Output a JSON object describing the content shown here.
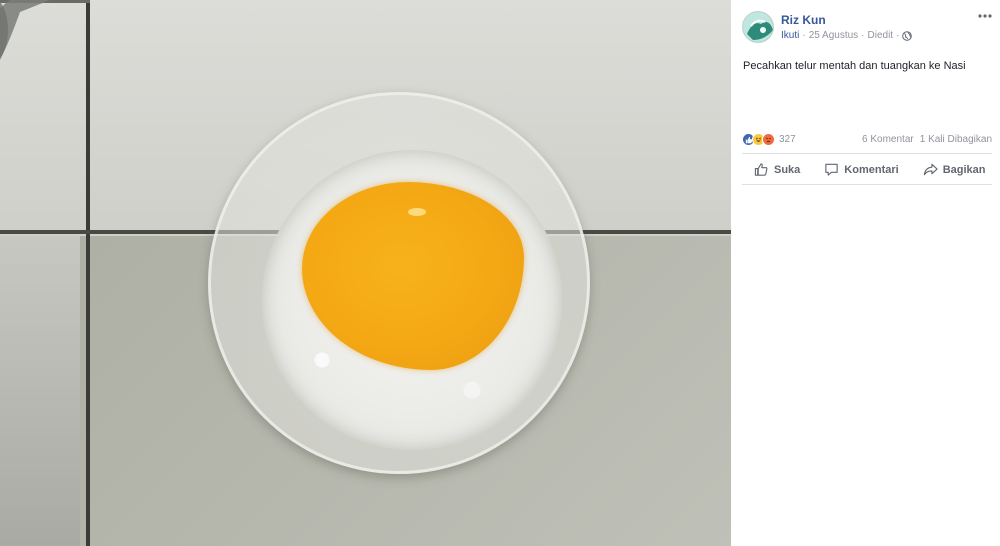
{
  "post": {
    "author": "Riz Kun",
    "follow_label": "Ikuti",
    "separator": "·",
    "date": "25 Agustus",
    "edited": "Diedit",
    "text": "Pecahkan telur mentah dan tuangkan ke Nasi",
    "reaction_count": "327",
    "comments": "6 Komentar",
    "shares": "1 Kali Dibagikan"
  },
  "actions": {
    "like": "Suka",
    "comment": "Komentari",
    "share": "Bagikan"
  },
  "icons": {
    "avatar": "avatar",
    "globe": "globe-icon",
    "more": "more-options-icon",
    "like_reaction": "like-reaction-icon",
    "haha_reaction": "haha-reaction-icon",
    "angry_reaction": "angry-reaction-icon",
    "like_action": "thumbs-up-icon",
    "comment_action": "comment-bubble-icon",
    "share_action": "share-arrow-icon"
  },
  "colors": {
    "link": "#365899",
    "muted": "#90949c",
    "action_text": "#616770",
    "like_blue": "#4267b2",
    "yolk": "#f4a814"
  }
}
